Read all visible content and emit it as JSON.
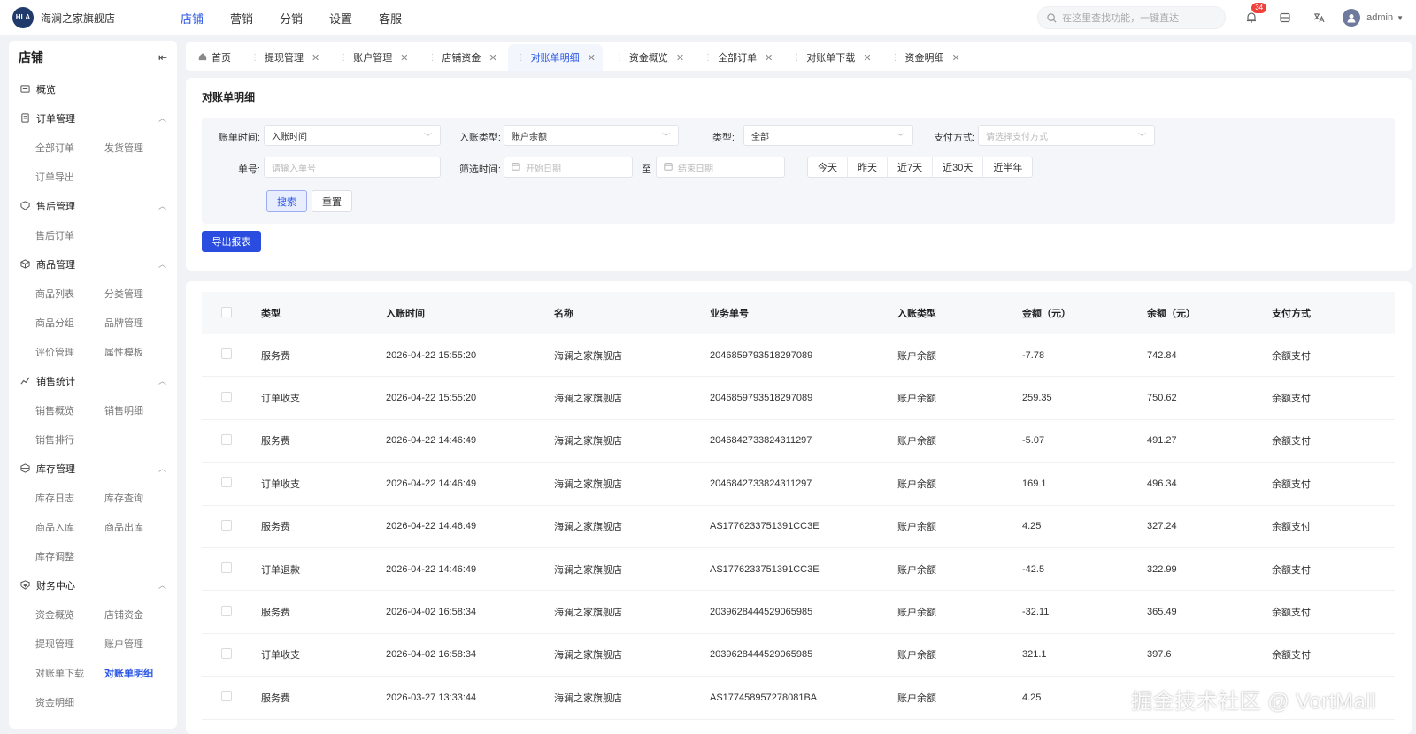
{
  "brand": {
    "badge": "HLA",
    "name": "海澜之家旗舰店"
  },
  "topnav": [
    "店铺",
    "营销",
    "分销",
    "设置",
    "客服"
  ],
  "header": {
    "search_placeholder": "在这里查找功能，一键直达",
    "notification_count": "34",
    "user": "admin"
  },
  "sidebar": {
    "title": "店铺",
    "groups": [
      {
        "label": "概览",
        "icon": "overview-icon",
        "items": []
      },
      {
        "label": "订单管理",
        "icon": "order-icon",
        "items": [
          "全部订单",
          "发货管理",
          "订单导出"
        ]
      },
      {
        "label": "售后管理",
        "icon": "aftersale-icon",
        "items": [
          "售后订单"
        ]
      },
      {
        "label": "商品管理",
        "icon": "product-icon",
        "items": [
          "商品列表",
          "分类管理",
          "商品分组",
          "品牌管理",
          "评价管理",
          "属性模板"
        ]
      },
      {
        "label": "销售统计",
        "icon": "stats-icon",
        "items": [
          "销售概览",
          "销售明细",
          "销售排行"
        ]
      },
      {
        "label": "库存管理",
        "icon": "inventory-icon",
        "items": [
          "库存日志",
          "库存查询",
          "商品入库",
          "商品出库",
          "库存调整"
        ]
      },
      {
        "label": "财务中心",
        "icon": "finance-icon",
        "items": [
          "资金概览",
          "店铺资金",
          "提现管理",
          "账户管理",
          "对账单下载",
          "对账单明细",
          "资金明细"
        ]
      }
    ],
    "active_item": "对账单明细"
  },
  "tabs": [
    {
      "label": "首页",
      "home": true,
      "closable": false
    },
    {
      "label": "提现管理",
      "closable": true
    },
    {
      "label": "账户管理",
      "closable": true
    },
    {
      "label": "店铺资金",
      "closable": true
    },
    {
      "label": "对账单明细",
      "closable": true,
      "active": true
    },
    {
      "label": "资金概览",
      "closable": true
    },
    {
      "label": "全部订单",
      "closable": true
    },
    {
      "label": "对账单下载",
      "closable": true
    },
    {
      "label": "资金明细",
      "closable": true
    }
  ],
  "filter": {
    "title": "对账单明细",
    "bill_time_label": "账单时间:",
    "bill_time_value": "入账时间",
    "entry_type_label": "入账类型:",
    "entry_type_value": "账户余额",
    "type_label": "类型:",
    "type_value": "全部",
    "pay_method_label": "支付方式:",
    "pay_method_placeholder": "请选择支付方式",
    "order_no_label": "单号:",
    "order_no_placeholder": "请输入单号",
    "date_label": "筛选时间:",
    "start_placeholder": "开始日期",
    "to": "至",
    "end_placeholder": "结束日期",
    "quick": [
      "今天",
      "昨天",
      "近7天",
      "近30天",
      "近半年"
    ],
    "search_btn": "搜索",
    "reset_btn": "重置",
    "export_btn": "导出报表"
  },
  "table": {
    "columns": [
      "类型",
      "入账时间",
      "名称",
      "业务单号",
      "入账类型",
      "金额（元）",
      "余额（元）",
      "支付方式"
    ],
    "rows": [
      [
        "服务费",
        "2026-04-22 15:55:20",
        "海澜之家旗舰店",
        "2046859793518297089",
        "账户余额",
        "-7.78",
        "742.84",
        "余额支付"
      ],
      [
        "订单收支",
        "2026-04-22 15:55:20",
        "海澜之家旗舰店",
        "2046859793518297089",
        "账户余额",
        "259.35",
        "750.62",
        "余额支付"
      ],
      [
        "服务费",
        "2026-04-22 14:46:49",
        "海澜之家旗舰店",
        "2046842733824311297",
        "账户余额",
        "-5.07",
        "491.27",
        "余额支付"
      ],
      [
        "订单收支",
        "2026-04-22 14:46:49",
        "海澜之家旗舰店",
        "2046842733824311297",
        "账户余额",
        "169.1",
        "496.34",
        "余额支付"
      ],
      [
        "服务费",
        "2026-04-22 14:46:49",
        "海澜之家旗舰店",
        "AS1776233751391CC3E",
        "账户余额",
        "4.25",
        "327.24",
        "余额支付"
      ],
      [
        "订单退款",
        "2026-04-22 14:46:49",
        "海澜之家旗舰店",
        "AS1776233751391CC3E",
        "账户余额",
        "-42.5",
        "322.99",
        "余额支付"
      ],
      [
        "服务费",
        "2026-04-02 16:58:34",
        "海澜之家旗舰店",
        "2039628444529065985",
        "账户余额",
        "-32.11",
        "365.49",
        "余额支付"
      ],
      [
        "订单收支",
        "2026-04-02 16:58:34",
        "海澜之家旗舰店",
        "2039628444529065985",
        "账户余额",
        "321.1",
        "397.6",
        "余额支付"
      ],
      [
        "服务费",
        "2026-03-27 13:33:44",
        "海澜之家旗舰店",
        "AS177458957278081BA",
        "账户余额",
        "4.25",
        "",
        ""
      ]
    ]
  },
  "watermark": "掘金技术社区 @ VortMall",
  "colors": {
    "accent": "#2a55e5",
    "primary_button": "#2a4de0",
    "badge": "#f2413b"
  }
}
